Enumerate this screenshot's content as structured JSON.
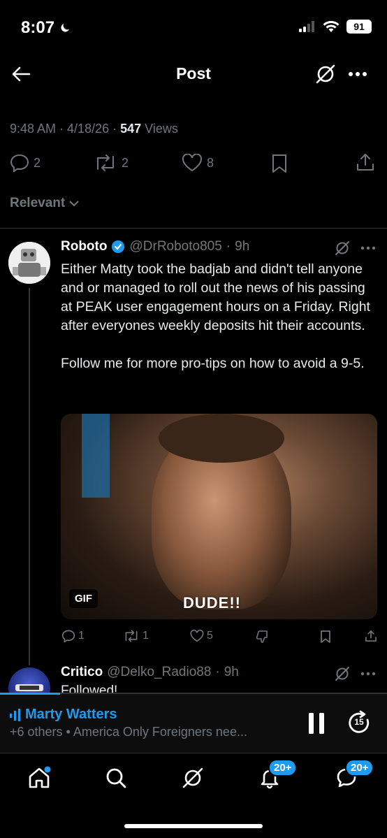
{
  "status_bar": {
    "time": "8:07",
    "battery": "91"
  },
  "header": {
    "title": "Post"
  },
  "post_meta": {
    "time": "9:48 AM",
    "date": "4/18/26",
    "views_count": "547",
    "views_label": "Views"
  },
  "post_actions": {
    "replies": "2",
    "reposts": "2",
    "likes": "8"
  },
  "sort": {
    "label": "Relevant"
  },
  "reply1": {
    "name": "Roboto",
    "handle": "@DrRoboto805",
    "age": "9h",
    "text_p1": "Either Matty took the badjab and didn't tell anyone and or managed to roll out the news of his passing at PEAK user engagement hours on a Friday. Right after everyones weekly deposits hit their accounts.",
    "text_p2": "Follow me for more pro-tips on how to avoid a 9-5.",
    "gif_badge": "GIF",
    "gif_caption": "DUDE!!",
    "replies": "1",
    "reposts": "1",
    "likes": "5"
  },
  "reply2": {
    "name": "Critico",
    "handle": "@Delko_Radio88",
    "age": "9h",
    "text": "Followed!"
  },
  "player": {
    "host": "Marty Watters",
    "subtitle": "+6 others • America Only Foreigners nee...",
    "skip_label": "15"
  },
  "tab_bar": {
    "notifications_badge": "20+",
    "messages_badge": "20+"
  },
  "colors": {
    "accent": "#1d9bf0",
    "muted": "#71767b",
    "background": "#000000"
  },
  "icons": [
    "moon-icon",
    "signal-icon",
    "wifi-icon",
    "back-arrow-icon",
    "grok-icon",
    "more-icon",
    "reply-icon",
    "repost-icon",
    "like-icon",
    "bookmark-icon",
    "share-icon",
    "chevron-down-icon",
    "verified-icon",
    "downvote-icon",
    "audio-bars-icon",
    "pause-icon",
    "skip-forward-icon",
    "home-icon",
    "search-icon",
    "notifications-icon",
    "messages-icon"
  ]
}
